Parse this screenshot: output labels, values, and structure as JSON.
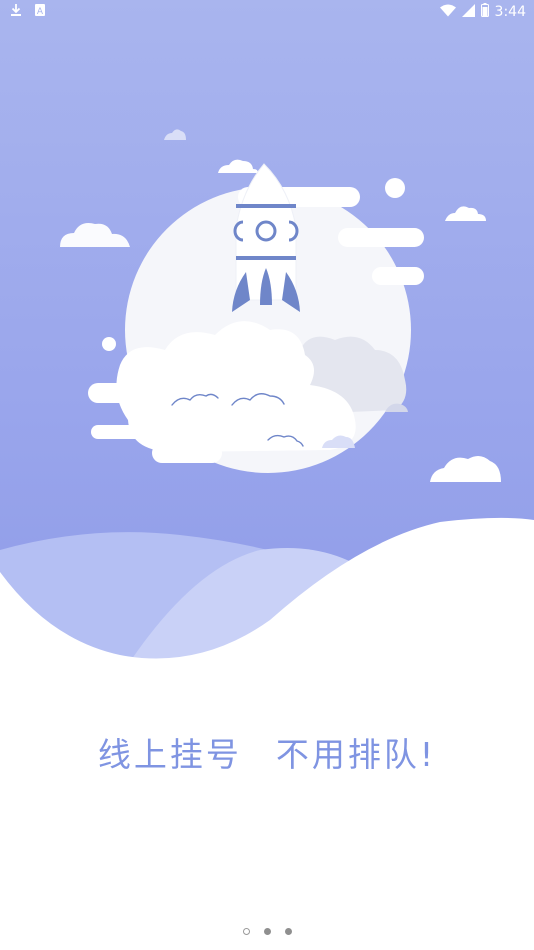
{
  "status_bar": {
    "time": "3:44",
    "left_icons": [
      "download-icon",
      "sim-icon"
    ],
    "right_icons": [
      "wifi-icon",
      "signal-icon",
      "battery-icon"
    ]
  },
  "illustration": {
    "subject": "rocket launching through clouds in front of moon"
  },
  "slogan": {
    "part1": "线上挂号",
    "part2": "不用排队!"
  },
  "pager": {
    "total": 3,
    "current": 1
  },
  "colors": {
    "hero_top": "#a9b5ee",
    "hero_bottom": "#8e9be8",
    "slogan_text": "#7f94e2",
    "rocket_blue": "#6f86c9"
  }
}
